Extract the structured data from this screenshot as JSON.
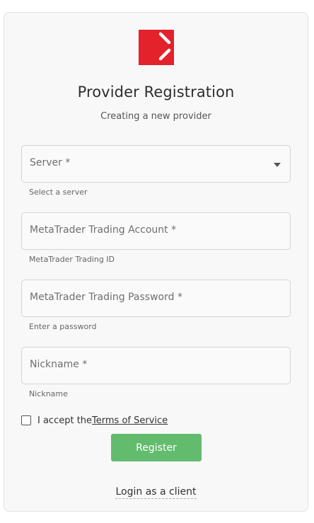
{
  "header": {
    "title": "Provider Registration",
    "subtitle": "Creating a new provider"
  },
  "form": {
    "server": {
      "placeholder": "Server *",
      "hint": "Select a server"
    },
    "account": {
      "placeholder": "MetaTrader Trading Account *",
      "hint": "MetaTrader Trading ID"
    },
    "password": {
      "placeholder": "MetaTrader Trading Password *",
      "hint": "Enter a password"
    },
    "nickname": {
      "placeholder": "Nickname *",
      "hint": "Nickname"
    },
    "terms": {
      "prefix": "I accept the",
      "link": "Terms of Service",
      "checked": false
    },
    "register_label": "Register",
    "login_link": "Login as a client"
  },
  "colors": {
    "brand": "#e3222b",
    "button": "#63bb6d"
  },
  "icons": {
    "logo": "brand-logo-icon",
    "dropdown": "chevron-down-icon",
    "checkbox": "checkbox-icon"
  }
}
